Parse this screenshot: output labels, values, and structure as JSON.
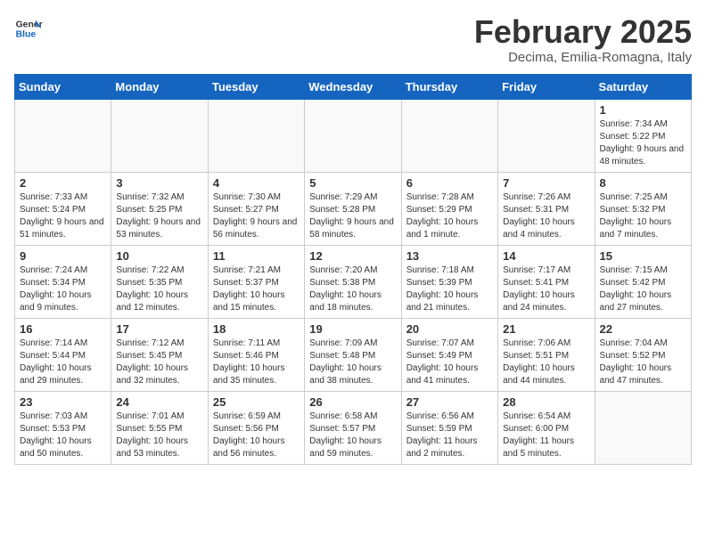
{
  "header": {
    "logo_line1": "General",
    "logo_line2": "Blue",
    "month": "February 2025",
    "location": "Decima, Emilia-Romagna, Italy"
  },
  "weekdays": [
    "Sunday",
    "Monday",
    "Tuesday",
    "Wednesday",
    "Thursday",
    "Friday",
    "Saturday"
  ],
  "weeks": [
    [
      {
        "num": "",
        "info": ""
      },
      {
        "num": "",
        "info": ""
      },
      {
        "num": "",
        "info": ""
      },
      {
        "num": "",
        "info": ""
      },
      {
        "num": "",
        "info": ""
      },
      {
        "num": "",
        "info": ""
      },
      {
        "num": "1",
        "info": "Sunrise: 7:34 AM\nSunset: 5:22 PM\nDaylight: 9 hours and 48 minutes."
      }
    ],
    [
      {
        "num": "2",
        "info": "Sunrise: 7:33 AM\nSunset: 5:24 PM\nDaylight: 9 hours and 51 minutes."
      },
      {
        "num": "3",
        "info": "Sunrise: 7:32 AM\nSunset: 5:25 PM\nDaylight: 9 hours and 53 minutes."
      },
      {
        "num": "4",
        "info": "Sunrise: 7:30 AM\nSunset: 5:27 PM\nDaylight: 9 hours and 56 minutes."
      },
      {
        "num": "5",
        "info": "Sunrise: 7:29 AM\nSunset: 5:28 PM\nDaylight: 9 hours and 58 minutes."
      },
      {
        "num": "6",
        "info": "Sunrise: 7:28 AM\nSunset: 5:29 PM\nDaylight: 10 hours and 1 minute."
      },
      {
        "num": "7",
        "info": "Sunrise: 7:26 AM\nSunset: 5:31 PM\nDaylight: 10 hours and 4 minutes."
      },
      {
        "num": "8",
        "info": "Sunrise: 7:25 AM\nSunset: 5:32 PM\nDaylight: 10 hours and 7 minutes."
      }
    ],
    [
      {
        "num": "9",
        "info": "Sunrise: 7:24 AM\nSunset: 5:34 PM\nDaylight: 10 hours and 9 minutes."
      },
      {
        "num": "10",
        "info": "Sunrise: 7:22 AM\nSunset: 5:35 PM\nDaylight: 10 hours and 12 minutes."
      },
      {
        "num": "11",
        "info": "Sunrise: 7:21 AM\nSunset: 5:37 PM\nDaylight: 10 hours and 15 minutes."
      },
      {
        "num": "12",
        "info": "Sunrise: 7:20 AM\nSunset: 5:38 PM\nDaylight: 10 hours and 18 minutes."
      },
      {
        "num": "13",
        "info": "Sunrise: 7:18 AM\nSunset: 5:39 PM\nDaylight: 10 hours and 21 minutes."
      },
      {
        "num": "14",
        "info": "Sunrise: 7:17 AM\nSunset: 5:41 PM\nDaylight: 10 hours and 24 minutes."
      },
      {
        "num": "15",
        "info": "Sunrise: 7:15 AM\nSunset: 5:42 PM\nDaylight: 10 hours and 27 minutes."
      }
    ],
    [
      {
        "num": "16",
        "info": "Sunrise: 7:14 AM\nSunset: 5:44 PM\nDaylight: 10 hours and 29 minutes."
      },
      {
        "num": "17",
        "info": "Sunrise: 7:12 AM\nSunset: 5:45 PM\nDaylight: 10 hours and 32 minutes."
      },
      {
        "num": "18",
        "info": "Sunrise: 7:11 AM\nSunset: 5:46 PM\nDaylight: 10 hours and 35 minutes."
      },
      {
        "num": "19",
        "info": "Sunrise: 7:09 AM\nSunset: 5:48 PM\nDaylight: 10 hours and 38 minutes."
      },
      {
        "num": "20",
        "info": "Sunrise: 7:07 AM\nSunset: 5:49 PM\nDaylight: 10 hours and 41 minutes."
      },
      {
        "num": "21",
        "info": "Sunrise: 7:06 AM\nSunset: 5:51 PM\nDaylight: 10 hours and 44 minutes."
      },
      {
        "num": "22",
        "info": "Sunrise: 7:04 AM\nSunset: 5:52 PM\nDaylight: 10 hours and 47 minutes."
      }
    ],
    [
      {
        "num": "23",
        "info": "Sunrise: 7:03 AM\nSunset: 5:53 PM\nDaylight: 10 hours and 50 minutes."
      },
      {
        "num": "24",
        "info": "Sunrise: 7:01 AM\nSunset: 5:55 PM\nDaylight: 10 hours and 53 minutes."
      },
      {
        "num": "25",
        "info": "Sunrise: 6:59 AM\nSunset: 5:56 PM\nDaylight: 10 hours and 56 minutes."
      },
      {
        "num": "26",
        "info": "Sunrise: 6:58 AM\nSunset: 5:57 PM\nDaylight: 10 hours and 59 minutes."
      },
      {
        "num": "27",
        "info": "Sunrise: 6:56 AM\nSunset: 5:59 PM\nDaylight: 11 hours and 2 minutes."
      },
      {
        "num": "28",
        "info": "Sunrise: 6:54 AM\nSunset: 6:00 PM\nDaylight: 11 hours and 5 minutes."
      },
      {
        "num": "",
        "info": ""
      }
    ]
  ]
}
